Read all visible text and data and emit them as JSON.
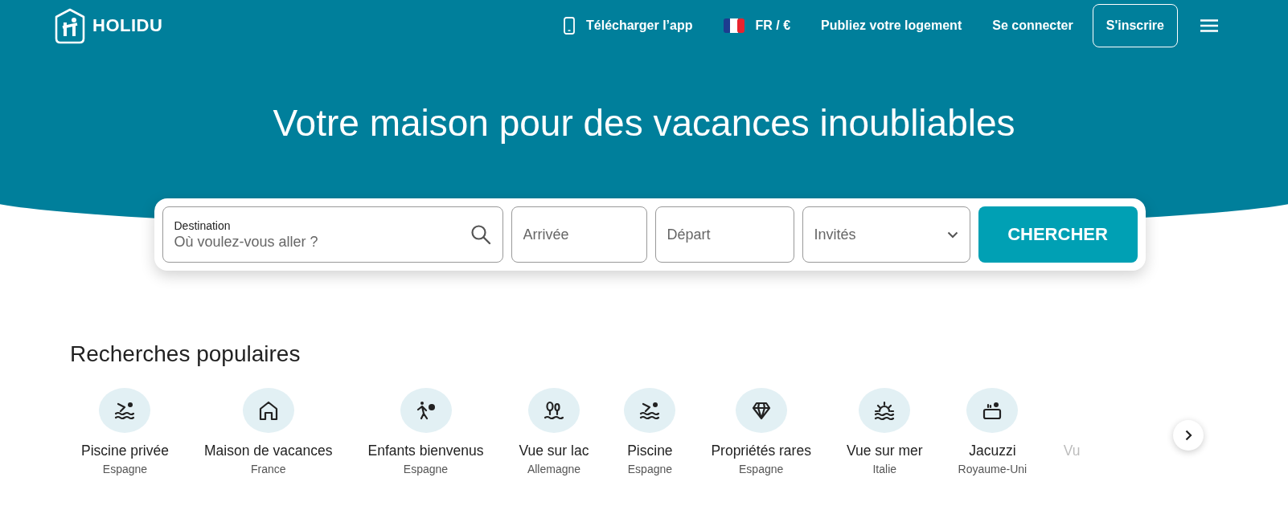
{
  "header": {
    "logo": "HOLIDU",
    "nav": [
      {
        "kind": "app",
        "label": "Télécharger l’app"
      },
      {
        "kind": "lang",
        "label": "FR / €"
      },
      {
        "kind": "link",
        "label": "Publiez votre logement"
      },
      {
        "kind": "link",
        "label": "Se connecter"
      },
      {
        "kind": "outline",
        "label": "S'inscrire"
      }
    ]
  },
  "hero": {
    "title": "Votre maison pour des vacances inoubliables"
  },
  "search": {
    "destination_label": "Destination",
    "destination_placeholder": "Où voulez-vous aller ?",
    "checkin_placeholder": "Arrivée",
    "checkout_placeholder": "Départ",
    "guests_placeholder": "Invités",
    "button": "CHERCHER"
  },
  "popular": {
    "title": "Recherches populaires",
    "items": [
      {
        "kind": "swim",
        "label": "Piscine privée",
        "country": "Espagne",
        "faded": false
      },
      {
        "kind": "house",
        "label": "Maison de vacances",
        "country": "France",
        "faded": false
      },
      {
        "kind": "kids",
        "label": "Enfants bienvenus",
        "country": "Espagne",
        "faded": false
      },
      {
        "kind": "lake",
        "label": "Vue sur lac",
        "country": "Allemagne",
        "faded": false
      },
      {
        "kind": "swim",
        "label": "Piscine",
        "country": "Espagne",
        "faded": false
      },
      {
        "kind": "diamond",
        "label": "Propriétés rares",
        "country": "Espagne",
        "faded": false
      },
      {
        "kind": "sea",
        "label": "Vue sur mer",
        "country": "Italie",
        "faded": false
      },
      {
        "kind": "jacuzzi",
        "label": "Jacuzzi",
        "country": "Royaume-Uni",
        "faded": false
      },
      {
        "kind": "none",
        "label": "Vu",
        "faded": true
      }
    ]
  }
}
